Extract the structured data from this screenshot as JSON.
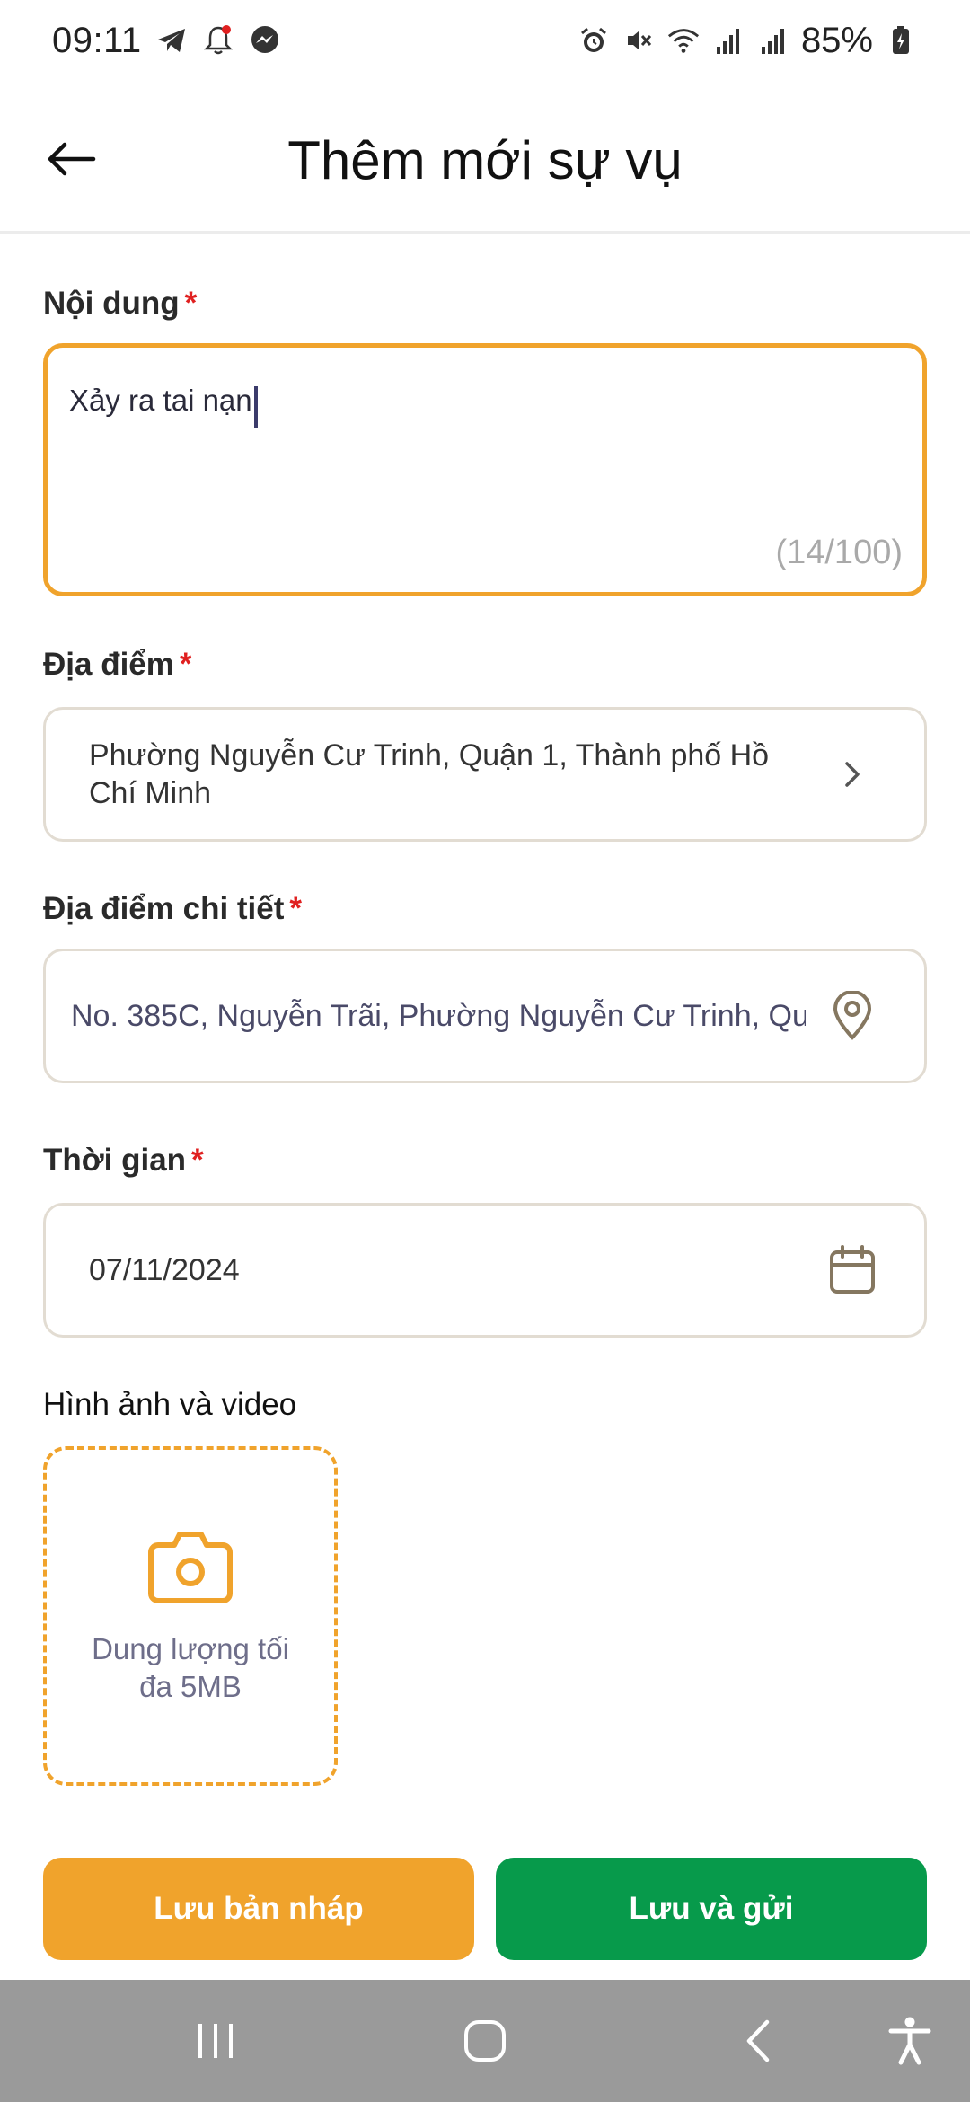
{
  "status_bar": {
    "time": "09:11",
    "battery": "85%",
    "left_icons": [
      "telegram-icon",
      "notification-bell-icon",
      "messenger-icon"
    ],
    "right_icons": [
      "alarm-icon",
      "mute-icon",
      "wifi-icon",
      "signal-icon",
      "signal-icon",
      "battery-icon"
    ]
  },
  "header": {
    "title": "Thêm mới sự vụ"
  },
  "form": {
    "content": {
      "label": "Nội dung",
      "required_mark": "*",
      "value": "Xảy ra tai nạn",
      "counter": "(14/100)"
    },
    "location": {
      "label": "Địa điểm",
      "required_mark": "*",
      "value": "Phường Nguyễn Cư Trinh, Quận 1, Thành phố Hồ Chí Minh"
    },
    "location_detail": {
      "label": "Địa điểm chi tiết",
      "required_mark": "*",
      "value": "No. 385C, Nguyễn Trãi, Phường Nguyễn Cư Trinh, Qu"
    },
    "time": {
      "label": "Thời gian",
      "required_mark": "*",
      "value": "07/11/2024"
    },
    "media": {
      "label": "Hình ảnh và video",
      "upload_hint": "Dung lượng tối đa 5MB"
    }
  },
  "actions": {
    "draft_label": "Lưu bản nháp",
    "send_label": "Lưu và gửi"
  },
  "colors": {
    "accent_orange": "#F0A32C",
    "accent_green": "#079A4B",
    "required_red": "#E02020",
    "nav_bar": "#9A9A9A"
  }
}
